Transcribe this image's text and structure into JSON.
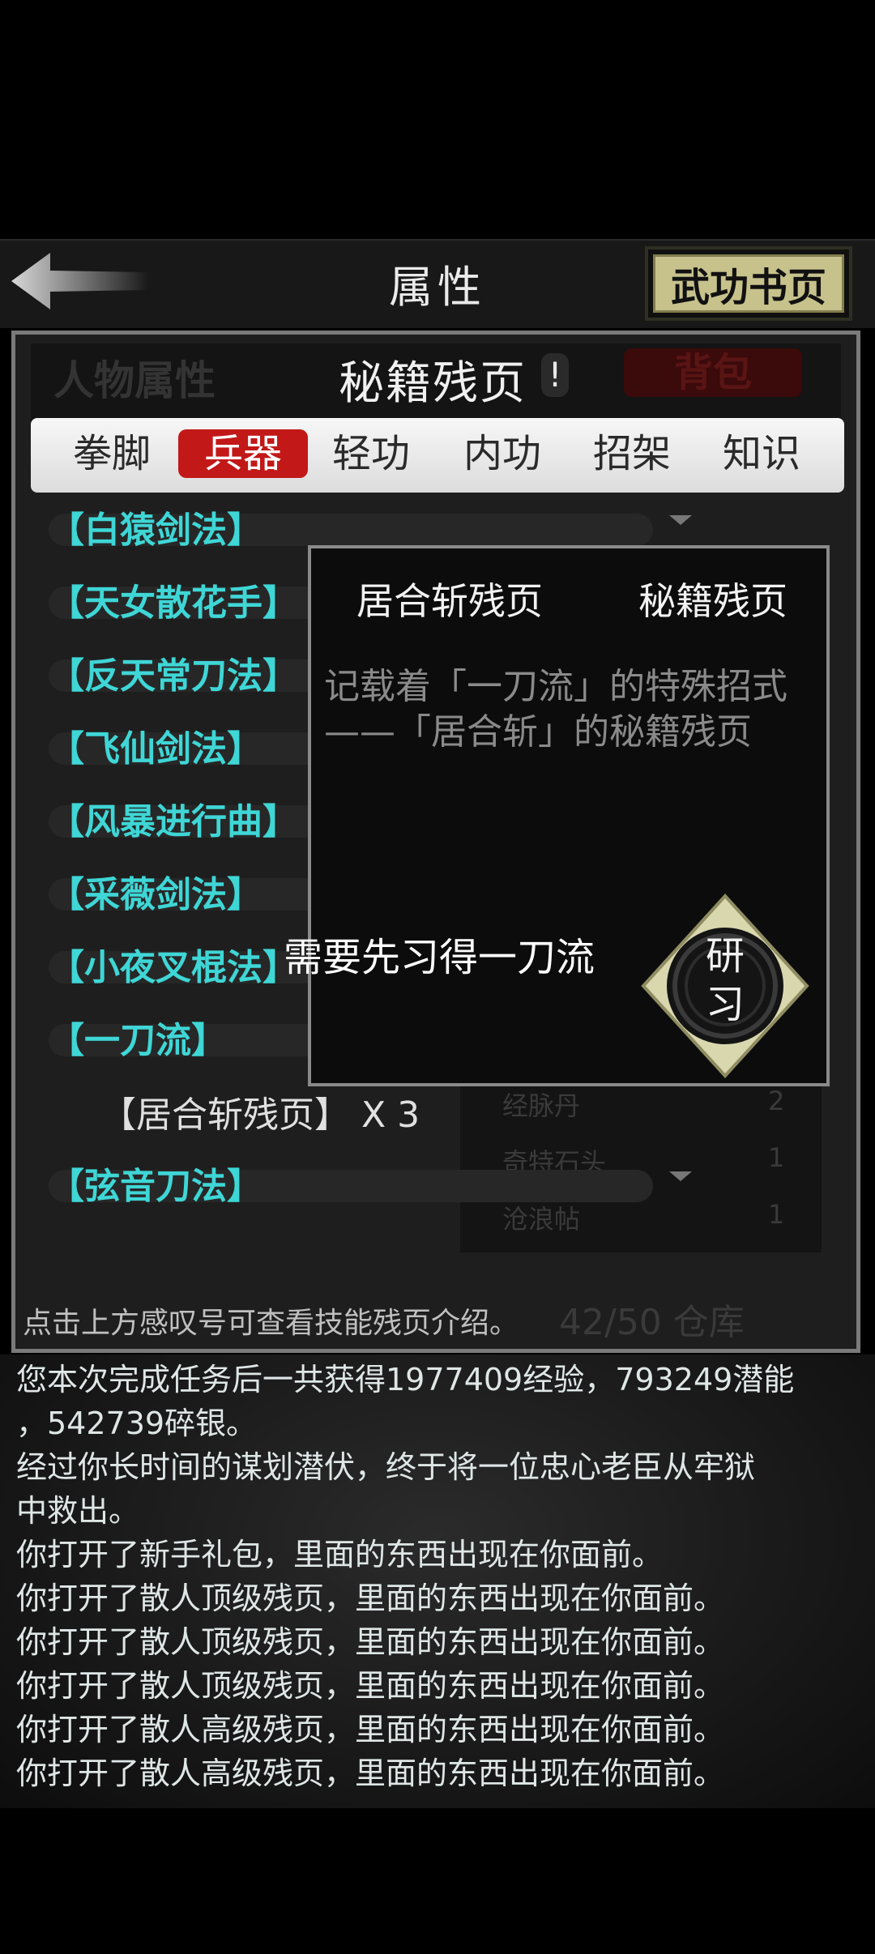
{
  "header": {
    "title": "属性",
    "book_pages_button": "武功书页"
  },
  "top_tabs": {
    "person": "人物属性",
    "secret": "秘籍残页",
    "alert": "!",
    "bag": "背包"
  },
  "categories": [
    "拳脚",
    "兵器",
    "轻功",
    "内功",
    "招架",
    "知识"
  ],
  "active_category": "兵器",
  "list": [
    "【白猿剑法】",
    "【天女散花手】",
    "【反天常刀法】",
    "【飞仙剑法】",
    "【风暴进行曲】",
    "【采薇剑法】",
    "【小夜叉棍法】",
    "【一刀流】",
    "【弦音刀法】"
  ],
  "sub_item": "【居合斩残页】 X 3",
  "popup": {
    "name": "居合斩残页",
    "type": "秘籍残页",
    "description": "记载着「一刀流」的特殊招式——「居合斩」的秘籍残页",
    "requirement": "需要先习得一刀流",
    "study_button": "研习"
  },
  "hint": "点击上方感叹号可查看技能残页介绍。",
  "background_ghost": {
    "items": [
      "经脉丹",
      "奇特石头",
      "沧浪帖"
    ],
    "counts": [
      "2",
      "1",
      "1"
    ],
    "footer": "42/50 仓库"
  },
  "log": [
    "您本次完成任务后一共获得1977409经验，793249潜能",
    "，542739碎银。",
    "经过你长时间的谋划潜伏，终于将一位忠心老臣从牢狱",
    "中救出。",
    "你打开了新手礼包，里面的东西出现在你面前。",
    "你打开了散人顶级残页，里面的东西出现在你面前。",
    "你打开了散人顶级残页，里面的东西出现在你面前。",
    "你打开了散人顶级残页，里面的东西出现在你面前。",
    "你打开了散人高级残页，里面的东西出现在你面前。",
    "你打开了散人高级残页，里面的东西出现在你面前。"
  ],
  "colors": {
    "skill_text": "#3fd6d6",
    "active_tab": "#c21818",
    "book_button": "#c7c28c",
    "study_diamond": "#d9d7ae"
  }
}
